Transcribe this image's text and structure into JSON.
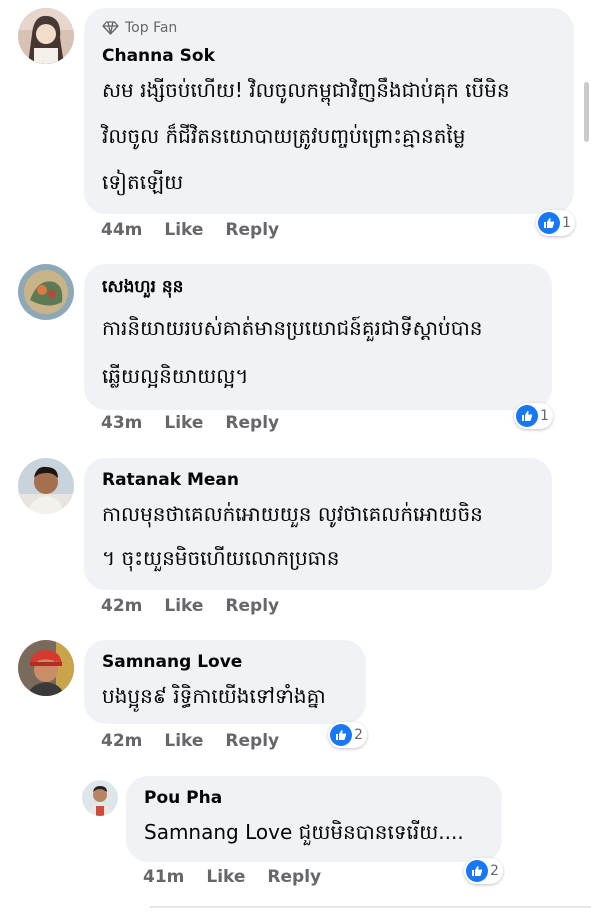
{
  "actions": {
    "like_label": "Like",
    "reply_label": "Reply"
  },
  "comments": [
    {
      "badge": "Top Fan",
      "author": "Channa Sok",
      "lines": [
        "សម រង្សីចប់ហើយ! វិលចូលកម្ពុជាវិញនឹងជាប់គុក បើមិន",
        "វិលចូល ក៏ជីវិតនយោបាយត្រូវបញ្ចប់ព្រោះគ្មានតម្លៃ",
        "ទៀតឡើយ"
      ],
      "time": "44m",
      "likes": "1"
    },
    {
      "author": "សេងហួរ នុន",
      "lines": [
        "ការនិយាយរបស់គាត់មានប្រយោជន៍គួរជាទីស្តាប់បាន",
        "ឆ្លើយល្អនិយាយល្អ។"
      ],
      "time": "43m",
      "likes": "1"
    },
    {
      "author": "Ratanak Mean",
      "lines": [
        "កាលមុនថាគេលក់អោយយួន លូវថាគេលក់អោយចិន",
        "។ ចុះយួនមិចហើយលោកប្រធាន"
      ],
      "time": "42m",
      "likes": ""
    },
    {
      "author": "Samnang Love",
      "lines": [
        "បងប្អូន៩ រិទ្ធិកាយើងទៅទាំងគ្នា"
      ],
      "time": "42m",
      "likes": "2"
    },
    {
      "author": "Pou Pha",
      "lines": [
        "Samnang Love ជួយមិនបានទេរើយ...."
      ],
      "time": "41m",
      "likes": "2"
    }
  ],
  "colors": {
    "bubble": "#f0f2f5",
    "meta": "#65676b",
    "like": "#1877f2"
  }
}
